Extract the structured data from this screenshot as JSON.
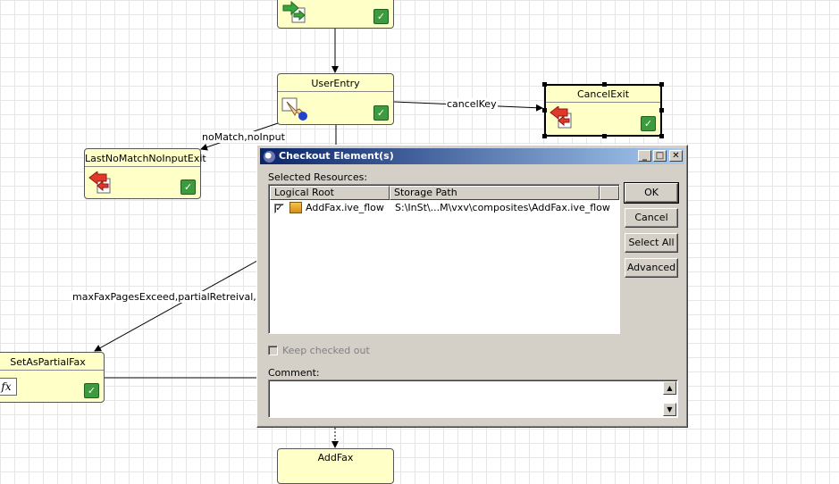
{
  "nodes": {
    "top_node": {
      "title": ""
    },
    "user_entry": {
      "title": "UserEntry"
    },
    "cancel_exit": {
      "title": "CancelExit"
    },
    "last_no_match": {
      "title": "LastNoMatchNoInputExit"
    },
    "set_partial": {
      "title": "SetAsPartialFax",
      "fx": "fx"
    },
    "add_fax": {
      "title": "AddFax"
    }
  },
  "wires": {
    "cancel_key": "cancelKey",
    "no_match": "noMatch,noInput",
    "max_fax": "maxFaxPagesExceed,partialRetreival,disco"
  },
  "dialog": {
    "title": "Checkout Element(s)",
    "selected_resources_label": "Selected Resources:",
    "columns": [
      "Logical Root",
      "Storage Path"
    ],
    "rows": [
      {
        "checked": true,
        "logical_root": "AddFax.ive_flow",
        "storage_path": "S:\\InSt\\...M\\vxv\\composites\\AddFax.ive_flow"
      }
    ],
    "buttons": {
      "ok": "OK",
      "cancel": "Cancel",
      "select_all": "Select All",
      "advanced": "Advanced"
    },
    "keep_checked_out": "Keep checked out",
    "comment_label": "Comment:"
  },
  "icons": {
    "check": "green-check-icon",
    "entry": "hand-pointer-icon",
    "exit": "red-arrow-exit-icon",
    "transfer": "green-arrow-icon"
  },
  "colors": {
    "node_fill": "#ffffc8",
    "title_gradient_start": "#0a246a",
    "title_gradient_end": "#a6caf0",
    "dialog_face": "#d4d0c8"
  }
}
